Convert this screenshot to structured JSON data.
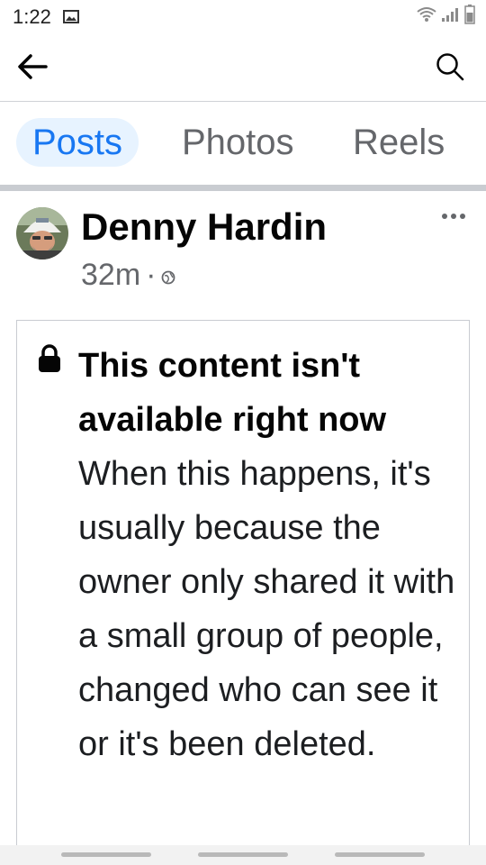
{
  "status_bar": {
    "time": "1:22",
    "icons": [
      "gallery-icon",
      "wifi-icon",
      "signal-icon",
      "battery-icon"
    ]
  },
  "appbar": {
    "back_icon": "arrow-left-icon",
    "search_icon": "search-icon"
  },
  "tabs": [
    {
      "label": "Posts",
      "active": true
    },
    {
      "label": "Photos",
      "active": false
    },
    {
      "label": "Reels",
      "active": false
    }
  ],
  "post": {
    "author": "Denny Hardin",
    "time": "32m",
    "separator": "·",
    "privacy_icon": "globe-icon",
    "more_icon": "more-horizontal-icon"
  },
  "notice": {
    "icon": "lock-icon",
    "title": "This content isn't available right now",
    "body": "When this happens, it's usually because the owner only shared it with a small group of people, changed who can see it or it's been deleted."
  },
  "colors": {
    "accent": "#1877f2",
    "active_tab_bg": "#e7f3ff",
    "muted_text": "#65676b",
    "divider": "#c9ccd1"
  }
}
